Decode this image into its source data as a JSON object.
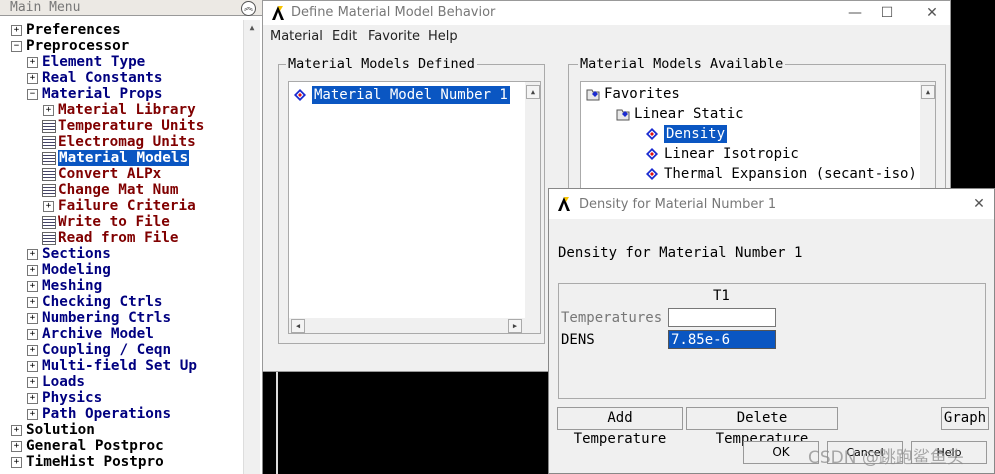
{
  "main_menu": {
    "title": "Main Menu",
    "items": [
      {
        "label": "Preferences",
        "level": 0,
        "type": "expander",
        "expanded": false,
        "color": "black"
      },
      {
        "label": "Preprocessor",
        "level": 0,
        "type": "expander",
        "expanded": true,
        "color": "black"
      },
      {
        "label": "Element Type",
        "level": 1,
        "type": "expander",
        "expanded": false,
        "color": "navy"
      },
      {
        "label": "Real Constants",
        "level": 1,
        "type": "expander",
        "expanded": false,
        "color": "navy"
      },
      {
        "label": "Material Props",
        "level": 1,
        "type": "expander",
        "expanded": true,
        "color": "navy"
      },
      {
        "label": "Material Library",
        "level": 2,
        "type": "expander",
        "expanded": false,
        "color": "dred"
      },
      {
        "label": "Temperature Units",
        "level": 2,
        "type": "grid",
        "color": "dred"
      },
      {
        "label": "Electromag Units",
        "level": 2,
        "type": "grid",
        "color": "dred"
      },
      {
        "label": "Material Models",
        "level": 2,
        "type": "grid",
        "color": "dred",
        "selected": true
      },
      {
        "label": "Convert ALPx",
        "level": 2,
        "type": "grid",
        "color": "dred"
      },
      {
        "label": "Change Mat Num",
        "level": 2,
        "type": "grid",
        "color": "dred"
      },
      {
        "label": "Failure Criteria",
        "level": 2,
        "type": "expander",
        "expanded": false,
        "color": "dred"
      },
      {
        "label": "Write to File",
        "level": 2,
        "type": "grid",
        "color": "dred"
      },
      {
        "label": "Read from File",
        "level": 2,
        "type": "grid",
        "color": "dred"
      },
      {
        "label": "Sections",
        "level": 1,
        "type": "expander",
        "expanded": false,
        "color": "navy"
      },
      {
        "label": "Modeling",
        "level": 1,
        "type": "expander",
        "expanded": false,
        "color": "navy"
      },
      {
        "label": "Meshing",
        "level": 1,
        "type": "expander",
        "expanded": false,
        "color": "navy"
      },
      {
        "label": "Checking Ctrls",
        "level": 1,
        "type": "expander",
        "expanded": false,
        "color": "navy"
      },
      {
        "label": "Numbering Ctrls",
        "level": 1,
        "type": "expander",
        "expanded": false,
        "color": "navy"
      },
      {
        "label": "Archive Model",
        "level": 1,
        "type": "expander",
        "expanded": false,
        "color": "navy"
      },
      {
        "label": "Coupling / Ceqn",
        "level": 1,
        "type": "expander",
        "expanded": false,
        "color": "navy"
      },
      {
        "label": "Multi-field Set Up",
        "level": 1,
        "type": "expander",
        "expanded": false,
        "color": "navy"
      },
      {
        "label": "Loads",
        "level": 1,
        "type": "expander",
        "expanded": false,
        "color": "navy"
      },
      {
        "label": "Physics",
        "level": 1,
        "type": "expander",
        "expanded": false,
        "color": "navy"
      },
      {
        "label": "Path Operations",
        "level": 1,
        "type": "expander",
        "expanded": false,
        "color": "navy"
      },
      {
        "label": "Solution",
        "level": 0,
        "type": "expander",
        "expanded": false,
        "color": "black"
      },
      {
        "label": "General Postproc",
        "level": 0,
        "type": "expander",
        "expanded": false,
        "color": "black"
      },
      {
        "label": "TimeHist Postpro",
        "level": 0,
        "type": "expander",
        "expanded": false,
        "color": "black"
      }
    ]
  },
  "material_window": {
    "title": "Define Material Model Behavior",
    "menu": [
      "Material",
      "Edit",
      "Favorite",
      "Help"
    ],
    "defined": {
      "title": "Material Models Defined",
      "items": [
        "Material Model Number 1"
      ]
    },
    "available": {
      "title": "Material Models Available",
      "favorites_label": "Favorites",
      "linear_static_label": "Linear Static",
      "models": [
        "Density",
        "Linear Isotropic",
        "Thermal Expansion (secant-iso)"
      ]
    }
  },
  "density_dialog": {
    "title": "Density for Material Number 1",
    "heading": "Density for Material Number 1",
    "column_header": "T1",
    "temperatures_label": "Temperatures",
    "temperature_value": "",
    "dens_label": "DENS",
    "dens_value": "7.85e-6",
    "buttons": {
      "add_temperature": "Add Temperature",
      "delete_temperature": "Delete Temperature",
      "graph": "Graph",
      "ok": "OK",
      "cancel": "Cancel",
      "help": "Help"
    },
    "watermark": "CSDN @跳跑鲨鱼头"
  },
  "colors": {
    "selection": "#0a56c2",
    "navy": "#000080",
    "dark_red": "#800000",
    "ansys_icon": "#f7c400"
  },
  "icons": {
    "window_minimize": "—",
    "window_maximize": "☐",
    "window_close": "✕",
    "collapse": "︽"
  }
}
